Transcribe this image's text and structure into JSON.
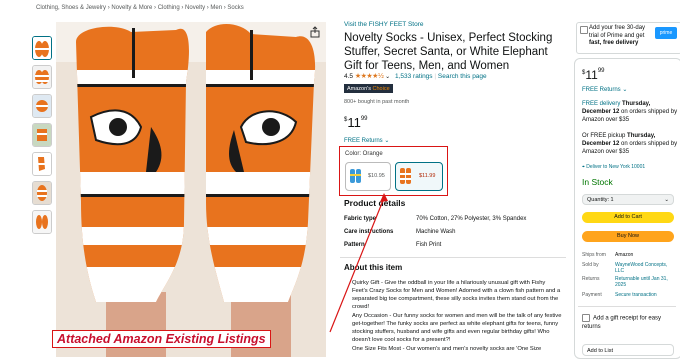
{
  "breadcrumb": "Clothing, Shoes & Jewelry › Novelty & More › Clothing › Novelty › Men › Socks",
  "product": {
    "visit_store": "Visit the FISHY FEET Store",
    "title": "Novelty Socks - Unisex, Perfect Stocking Stuffer, Secret Santa, or White Elephant Gift for Teens, Men, and Women",
    "rating": "4.5",
    "ratings_count": "1,533 ratings",
    "search_page": "Search this page",
    "badge_amazon": "Amazon's",
    "badge_choice": "Choice",
    "bought": "800+ bought in past month",
    "price_dollars": "11",
    "price_cents": "99",
    "free_returns": "FREE Returns",
    "color_label": "Color: Orange",
    "swatches": [
      {
        "price": "$10.95"
      },
      {
        "price": "$11.99"
      }
    ],
    "details_heading": "Product details",
    "specs": [
      {
        "key": "Fabric type",
        "value": "70% Cotton, 27% Polyester, 3% Spandex"
      },
      {
        "key": "Care instructions",
        "value": "Machine Wash"
      },
      {
        "key": "Pattern",
        "value": "Fish Print"
      }
    ],
    "about_heading": "About this item",
    "bullets": [
      "Quirky Gift - Give the oddball in your life a hilariously unusual gift with Fishy Feet's Crazy Socks for Men and Women! Adorned with a clown fish pattern and a separated big toe compartment, these silly socks invites them stand out from the crowd!",
      "Any Occasion - Our funny socks for women and men will be the talk of any festive get-together! The funky socks are perfect as white elephant gifts for teens, funny stocking stuffers, husband and wife gifts and even regular birthday gifts! Who doesn't love cool socks for a present?!",
      "One Size Fits Most - Our women's and men's novelty socks are 'One Size"
    ]
  },
  "annotation": "Attached Amazon Existing Listings",
  "buybox": {
    "prime_line1": "Add your free 30-day trial of Prime and get",
    "prime_line2": "fast, free delivery",
    "price_dollars": "11",
    "price_cents": "99",
    "free_returns": "FREE Returns",
    "delivery_prefix": "FREE delivery",
    "delivery_day": "Thursday, December 12",
    "delivery_suffix": "on orders shipped by Amazon over $35",
    "pickup_prefix": "Or FREE pickup",
    "pickup_day": "Thursday, December 12",
    "pickup_suffix": "on orders shipped by Amazon over $35",
    "deliver_to": "Deliver to New York 10001",
    "in_stock": "In Stock",
    "quantity": "Quantity: 1",
    "add_to_cart": "Add to Cart",
    "buy_now": "Buy Now",
    "ships_from_label": "Ships from",
    "ships_from": "Amazon",
    "sold_by_label": "Sold by",
    "sold_by": "WayneWood Concepts, LLC",
    "returns_label": "Returns",
    "returns": "Returnable until Jan 31, 2025",
    "payment_label": "Payment",
    "payment": "Secure transaction",
    "gift_receipt": "Add a gift receipt for easy returns",
    "add_to_list": "Add to List"
  },
  "colors": {
    "accent_orange": "#e8731e",
    "annotation_red": "#d91515",
    "link_teal": "#007185"
  }
}
